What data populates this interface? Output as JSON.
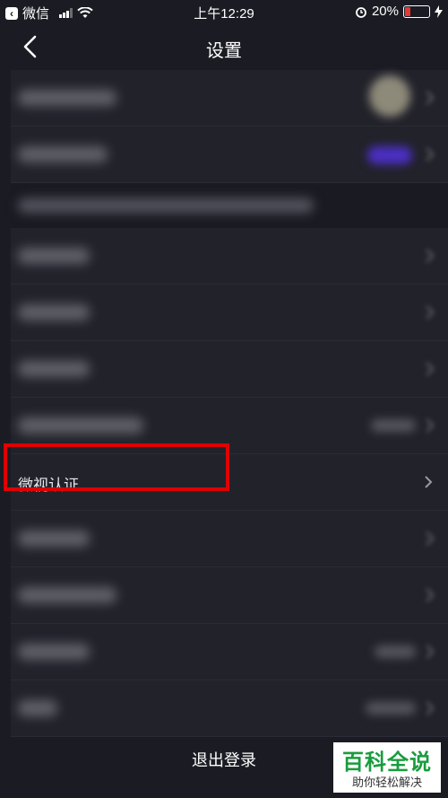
{
  "status_bar": {
    "back_app_label": "微信",
    "time": "上午12:29",
    "battery": "20%",
    "battery_level": 0.2
  },
  "nav": {
    "title": "设置"
  },
  "rows": {
    "verification_label": "微视认证"
  },
  "footer": {
    "logout_label": "退出登录"
  },
  "watermark": {
    "top": "百科全说",
    "bottom": "助你轻松解决"
  },
  "colors": {
    "background": "#1b1b23",
    "row": "#22222b",
    "highlight_border": "#e00000",
    "watermark_green": "#1a9c3e"
  }
}
